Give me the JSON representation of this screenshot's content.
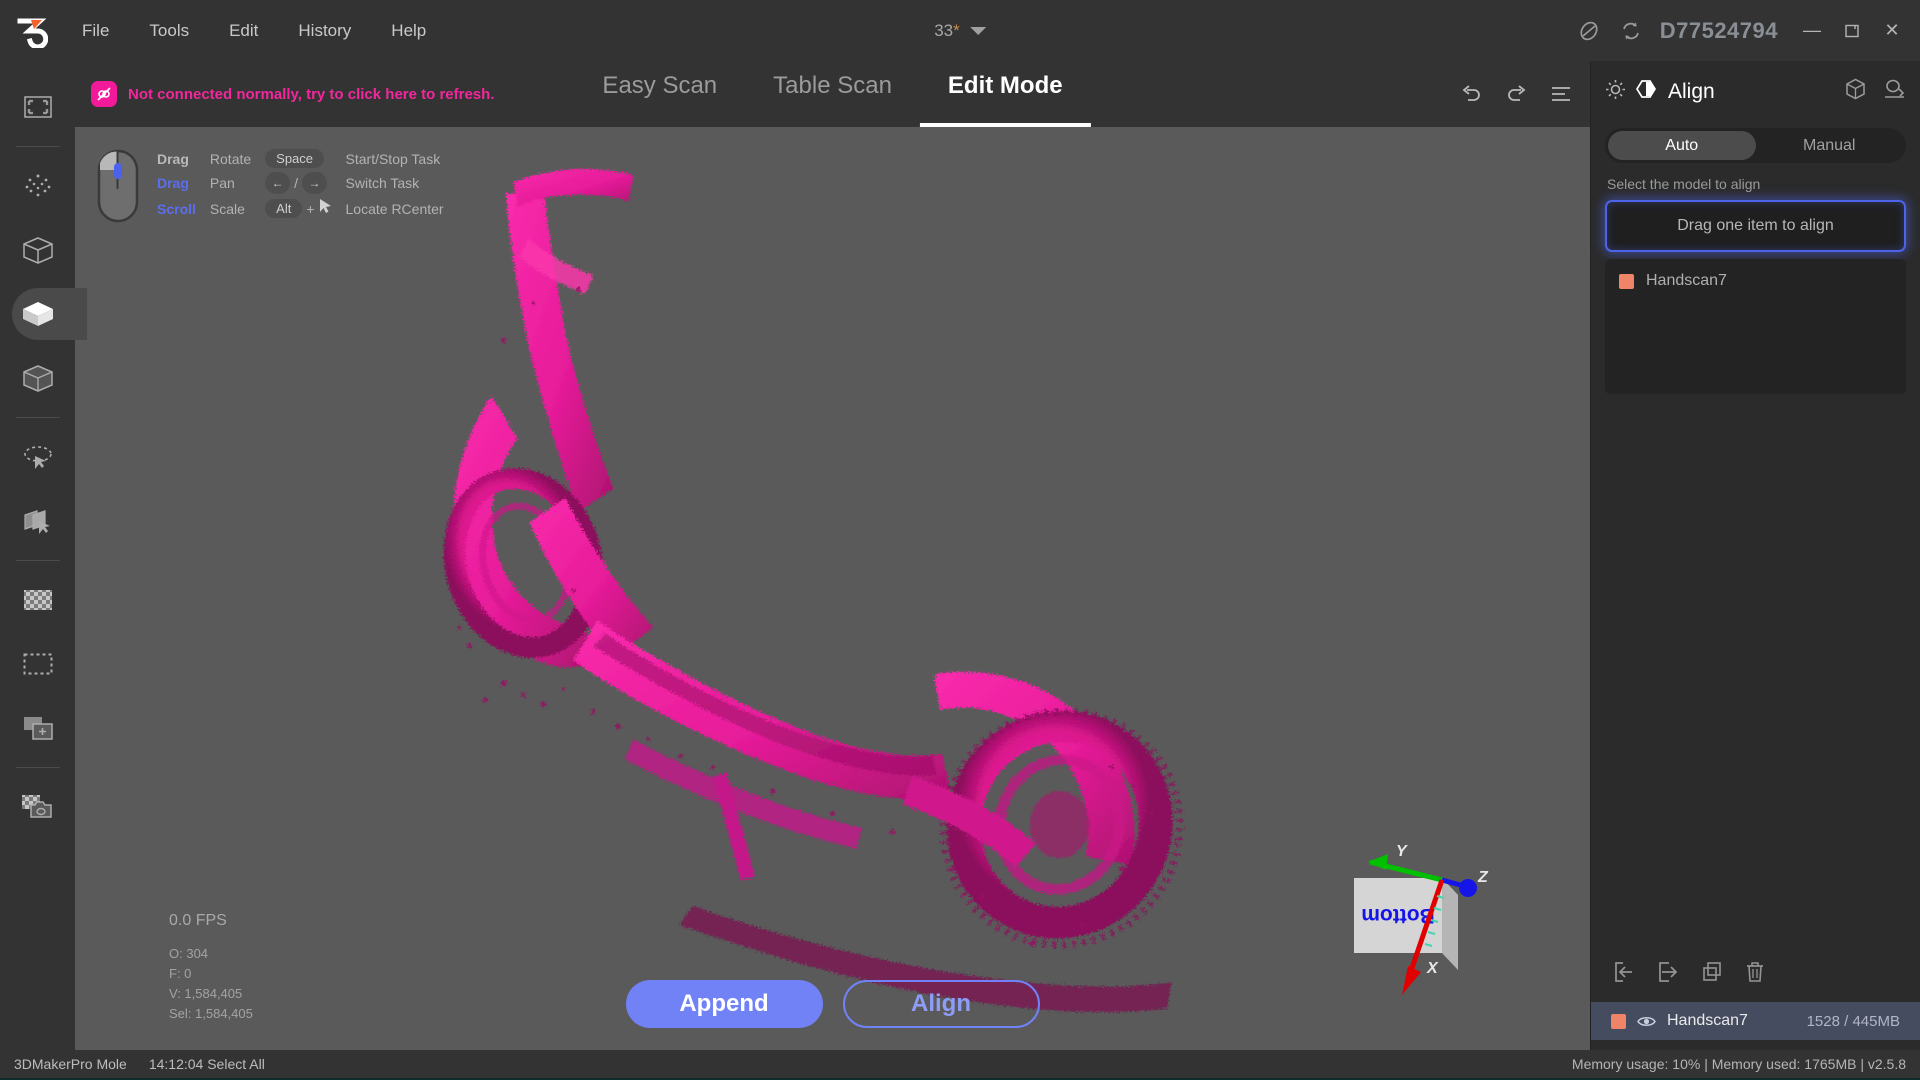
{
  "titlebar": {
    "logo_icon": "logo-3dmakerpro",
    "menu": [
      {
        "label": "File"
      },
      {
        "label": "Tools"
      },
      {
        "label": "Edit"
      },
      {
        "label": "History"
      },
      {
        "label": "Help"
      }
    ],
    "zoom_value": "33",
    "zoom_modified_marker": "*",
    "chevron_icon": "chevron-down-icon",
    "device_icon": "device-circle-icon",
    "refresh_icon": "refresh-icon",
    "serial": "D77524794",
    "minimize_label": "—",
    "maximize_icon": "maximize-icon",
    "close_label": "✕"
  },
  "left_toolbar": {
    "items": [
      {
        "name": "fit-to-view",
        "icon": "frame-icon"
      },
      {
        "name": "point-cloud-view",
        "icon": "point-cloud-icon"
      },
      {
        "name": "wireframe-view",
        "icon": "wireframe-cube-icon"
      },
      {
        "name": "solid-view",
        "icon": "solid-cube-icon",
        "active": true
      },
      {
        "name": "transparent-view",
        "icon": "transparent-cube-icon"
      },
      {
        "name": "lasso-select",
        "icon": "lasso-select-icon"
      },
      {
        "name": "plane-select",
        "icon": "plane-select-icon"
      },
      {
        "name": "texture-toggle",
        "icon": "checkerboard-icon"
      },
      {
        "name": "marquee-select",
        "icon": "dashed-rect-icon"
      },
      {
        "name": "add-layer",
        "icon": "add-plus-box-icon"
      },
      {
        "name": "snapshot",
        "icon": "camera-icon"
      }
    ]
  },
  "subbar": {
    "warning_icon": "broken-link-icon",
    "warning_text": "Not connected normally, try to click here to refresh.",
    "warning_color": "#f2279e",
    "tabs": [
      {
        "label": "Easy Scan",
        "active": false
      },
      {
        "label": "Table Scan",
        "active": false
      },
      {
        "label": "Edit Mode",
        "active": true
      }
    ],
    "undo_icon": "undo-icon",
    "redo_icon": "redo-icon",
    "list_icon": "list-lines-icon"
  },
  "viewport": {
    "help": {
      "mouse_icon": "mouse-icon",
      "rows": [
        {
          "key": "Drag",
          "key_style": "gray",
          "action": "Rotate"
        },
        {
          "key": "Drag",
          "key_style": "blue",
          "action": "Pan"
        },
        {
          "key": "Scroll",
          "key_style": "blue",
          "action": "Scale"
        }
      ],
      "shortcuts": [
        {
          "key": "Space",
          "action": "Start/Stop Task"
        },
        {
          "key": "← / →",
          "action": "Switch Task"
        },
        {
          "key": "Alt + ➤",
          "action": "Locate RCenter"
        }
      ],
      "key_space": "Space",
      "key_alt": "Alt",
      "plus": "+"
    },
    "stats": {
      "fps": "0.0 FPS",
      "objects": "O: 304",
      "faces": "F: 0",
      "vertices": "V: 1,584,405",
      "selected": "Sel: 1,584,405"
    },
    "actions": {
      "append_label": "Append",
      "align_label": "Align",
      "primary_color": "#7182f7"
    },
    "gizmo": {
      "face_label": "Bottom",
      "axis_x": "X",
      "axis_y": "Y",
      "axis_z": "Z",
      "x_color": "#e00000",
      "y_color": "#00c000",
      "z_color": "#1515e8"
    },
    "model_color": "#ec1a9c",
    "background_color": "#5a5a5a"
  },
  "right_panel": {
    "brightness_icon": "sun-icon",
    "align_icon": "align-hex-icon",
    "title": "Align",
    "cube_icon": "cube-icon",
    "measure_icon": "measure-icon",
    "modes": [
      {
        "label": "Auto",
        "selected": true
      },
      {
        "label": "Manual",
        "selected": false
      }
    ],
    "select_hint": "Select the model to align",
    "dropzone_text": "Drag one item to align",
    "align_items": [
      {
        "label": "Handscan7",
        "color": "#f08469"
      }
    ],
    "tools": [
      {
        "name": "import-button",
        "icon": "import-icon"
      },
      {
        "name": "export-button",
        "icon": "export-icon"
      },
      {
        "name": "duplicate-button",
        "icon": "duplicate-icon"
      },
      {
        "name": "delete-button",
        "icon": "trash-icon"
      }
    ],
    "model_row": {
      "color": "#f08469",
      "eye_icon": "eye-icon",
      "name": "Handscan7",
      "memory": "1528 / 445MB"
    }
  },
  "statusbar": {
    "device": "3DMakerPro Mole",
    "last_action": "14:12:04 Select All",
    "memory_info": "Memory usage: 10% | Memory used: 1765MB | v2.5.8"
  }
}
